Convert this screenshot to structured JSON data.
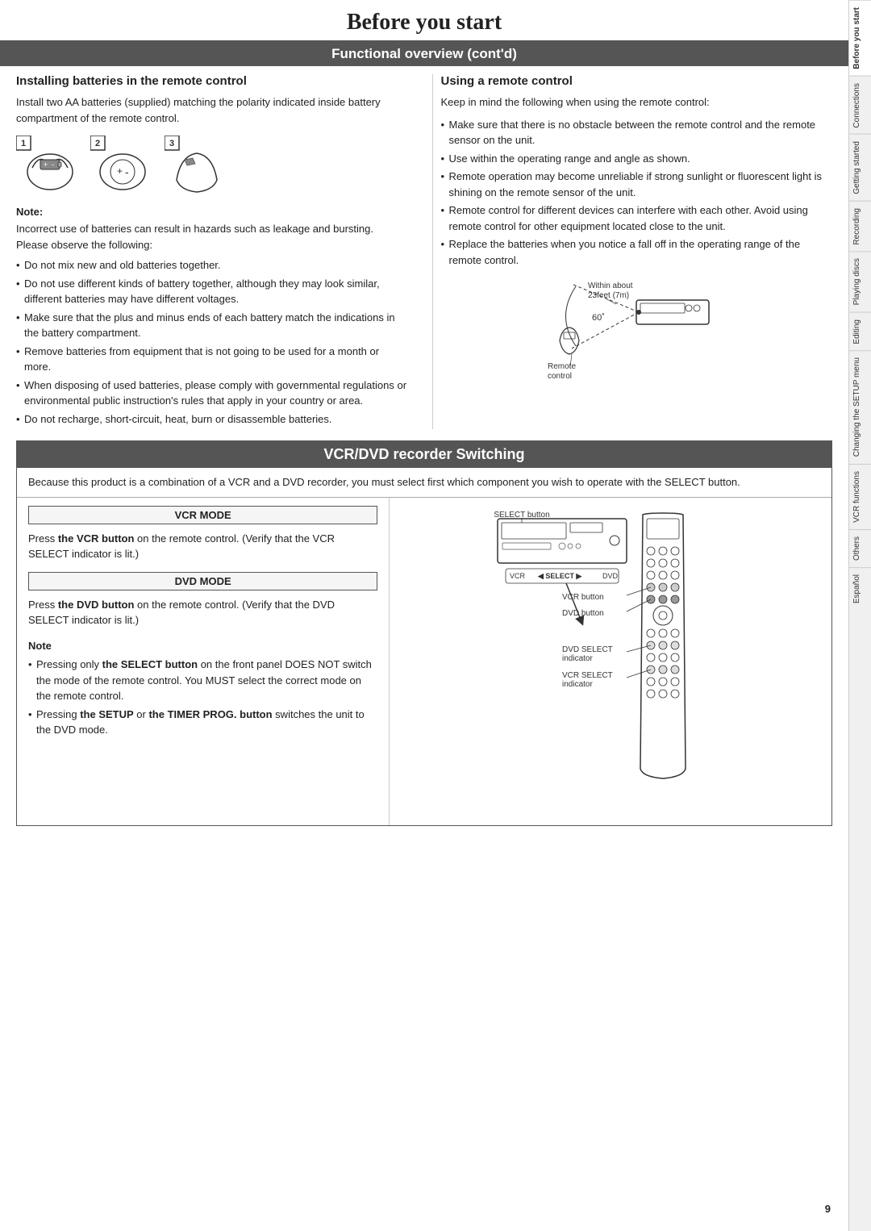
{
  "page": {
    "title": "Before you start",
    "section_header": "Functional overview (cont'd)",
    "page_number": "9"
  },
  "left_column": {
    "heading": "Installing batteries in the remote control",
    "intro_text": "Install two AA batteries (supplied) matching the polarity indicated inside battery compartment of the remote control.",
    "steps": [
      "1",
      "2",
      "3"
    ],
    "note_label": "Note:",
    "note_text": "Incorrect use of batteries can result in hazards such as leakage and bursting. Please observe the following:",
    "bullets": [
      "Do not mix new and old batteries together.",
      "Do not use different kinds of battery together, although they may look similar, different batteries may have different voltages.",
      "Make sure that the plus and minus ends of each battery match the indications in the battery compartment.",
      "Remove batteries from equipment that is not going to be used for a month or more.",
      "When disposing of used batteries, please comply with governmental regulations or environmental public instruction's rules that apply in your country or area.",
      "Do not recharge, short-circuit, heat, burn or disassemble batteries."
    ]
  },
  "right_column": {
    "heading": "Using a remote control",
    "intro_text": "Keep in mind the following when using the remote control:",
    "bullets": [
      "Make sure that there is no obstacle between the remote control and the remote sensor on the unit.",
      "Use within the operating range and angle as shown.",
      "Remote operation may become unreliable if strong sunlight or fluorescent light is shining on the remote sensor of the unit.",
      "Remote control for different devices can interfere with each other. Avoid using remote control for other equipment located close to the unit.",
      "Replace the batteries when you notice a fall off in the operating range of the remote control."
    ],
    "range_label_distance": "Within about 23feet (7m)",
    "range_label_angle": "60˚",
    "range_label_remote": "Remote control"
  },
  "vcr_dvd_section": {
    "header": "VCR/DVD recorder Switching",
    "intro": "Because this product is a combination of a VCR and a DVD recorder, you must select first which component you wish to operate with the SELECT button.",
    "vcr_mode_label": "VCR MODE",
    "vcr_mode_text": "Press the VCR button on the remote control. (Verify that the VCR SELECT indicator is lit.)",
    "dvd_mode_label": "DVD MODE",
    "dvd_mode_text": "Press the DVD button on the remote control. (Verify that the DVD SELECT indicator is lit.)",
    "diagram_labels": {
      "select_button": "SELECT button",
      "vcr_button": "VCR button",
      "dvd_button": "DVD button",
      "dvd_select": "DVD SELECT indicator",
      "vcr_select": "VCR SELECT indicator"
    },
    "note_label": "Note",
    "note_bullets": [
      "Pressing only the SELECT button on the front panel DOES NOT switch the mode of the remote control. You MUST select the correct mode on the remote control.",
      "Pressing the SETUP or the TIMER PROG. button switches the unit to the DVD mode."
    ]
  },
  "sidebar_tabs": [
    {
      "label": "Before you start",
      "active": true
    },
    {
      "label": "Connections",
      "active": false
    },
    {
      "label": "Getting started",
      "active": false
    },
    {
      "label": "Recording",
      "active": false
    },
    {
      "label": "Playing discs",
      "active": false
    },
    {
      "label": "Editing",
      "active": false
    },
    {
      "label": "Changing the SETUP menu",
      "active": false
    },
    {
      "label": "VCR functions",
      "active": false
    },
    {
      "label": "Others",
      "active": false
    },
    {
      "label": "Español",
      "active": false
    }
  ]
}
